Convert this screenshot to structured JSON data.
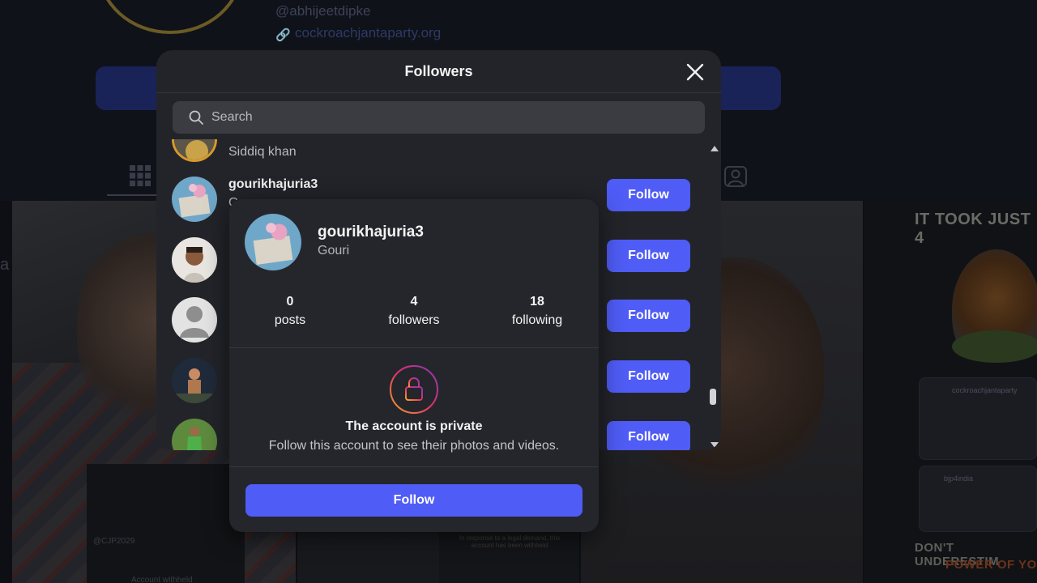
{
  "background": {
    "handle": "@abhijeetdipke",
    "website": "cockroachjantaparty.org",
    "tile_texts": {
      "poster_top": "IT TOOK JUST 4",
      "poster_bottom_line1": "DON'T UNDERESTIM",
      "poster_bottom_line2": "POWER OF YO",
      "card1_title": "cockroachjantaparty",
      "card2_title": "bjp4india",
      "dark_tile_handle": "@CJP2029",
      "dark_tile_caption": "Account withheld",
      "edge_letter": "a",
      "note_text": "In response to a legal demand, this account has been withheld"
    }
  },
  "modal": {
    "title": "Followers",
    "search_placeholder": "Search",
    "followers": [
      {
        "username": "",
        "fullname": "Siddiq khan",
        "button": ""
      },
      {
        "username": "gourikhajuria3",
        "fullname": "G",
        "button": "Follow"
      },
      {
        "username": "",
        "fullname": "",
        "button": "Follow"
      },
      {
        "username": "",
        "fullname": "",
        "button": "Follow"
      },
      {
        "username": "",
        "fullname": "",
        "button": "Follow"
      },
      {
        "username": "",
        "fullname": "",
        "button": "Follow"
      }
    ]
  },
  "hover_card": {
    "username": "gourikhajuria3",
    "fullname": "Gouri",
    "stats": [
      {
        "value": "0",
        "label": "posts"
      },
      {
        "value": "4",
        "label": "followers"
      },
      {
        "value": "18",
        "label": "following"
      }
    ],
    "private_title": "The account is private",
    "private_text": "Follow this account to see their photos and videos.",
    "follow_button": "Follow"
  },
  "colors": {
    "accent": "#4f5cf5",
    "modal_bg": "#23242a",
    "search_bg": "#3b3c41",
    "lock_gradient": [
      "#f5a623",
      "#e1306c",
      "#833ab4"
    ]
  },
  "icons": {
    "close": "close-icon",
    "search": "search-icon",
    "lock": "lock-icon",
    "grid": "grid-icon",
    "tagged": "tagged-icon",
    "link": "link-icon"
  }
}
